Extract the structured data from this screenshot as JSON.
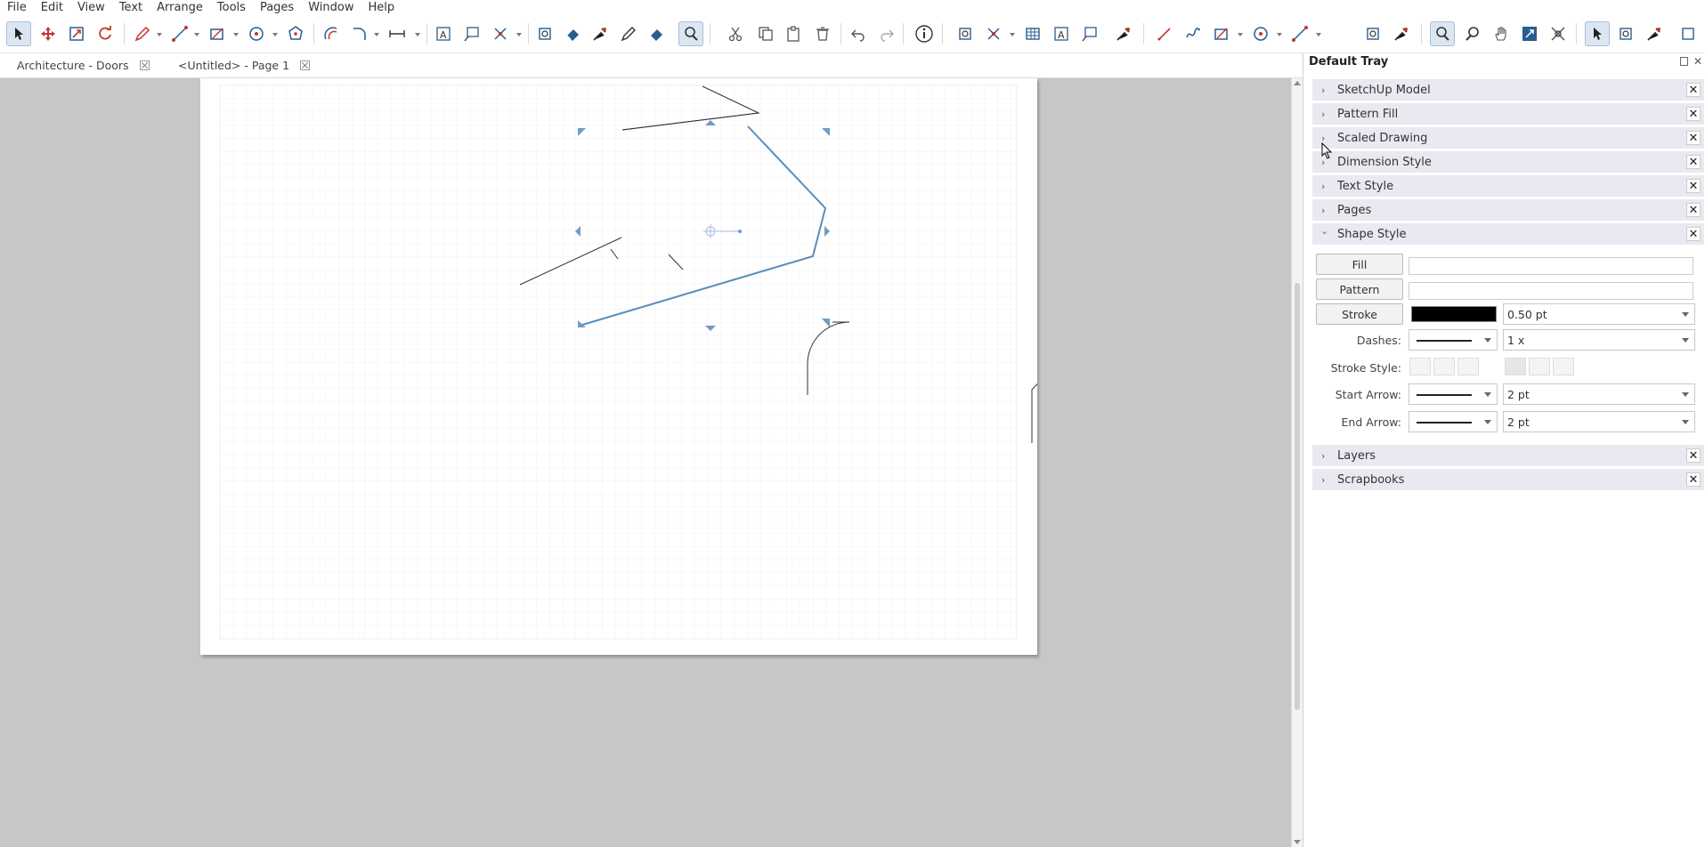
{
  "menu": [
    "File",
    "Edit",
    "View",
    "Text",
    "Arrange",
    "Tools",
    "Pages",
    "Window",
    "Help"
  ],
  "tabs": [
    {
      "label": "Architecture - Doors"
    },
    {
      "label": "<Untitled> - Page 1"
    }
  ],
  "tray": {
    "title": "Default Tray",
    "panels_top": [
      "SketchUp Model",
      "Pattern Fill",
      "Scaled Drawing",
      "Dimension Style",
      "Text Style",
      "Pages"
    ],
    "shape_style": {
      "title": "Shape Style",
      "fill_label": "Fill",
      "pattern_label": "Pattern",
      "stroke_label": "Stroke",
      "stroke_color": "#000000",
      "stroke_width": "0.50 pt",
      "dashes_label": "Dashes:",
      "dash_scale": "1 x",
      "stroke_style_label": "Stroke Style:",
      "start_arrow_label": "Start Arrow:",
      "start_arrow_size": "2 pt",
      "end_arrow_label": "End Arrow:",
      "end_arrow_size": "2 pt"
    },
    "panels_bottom": [
      "Layers",
      "Scrapbooks"
    ]
  },
  "colors": {
    "selection": "#5b8db8",
    "grid": "#f0eef4",
    "accent_red": "#c0392b"
  }
}
